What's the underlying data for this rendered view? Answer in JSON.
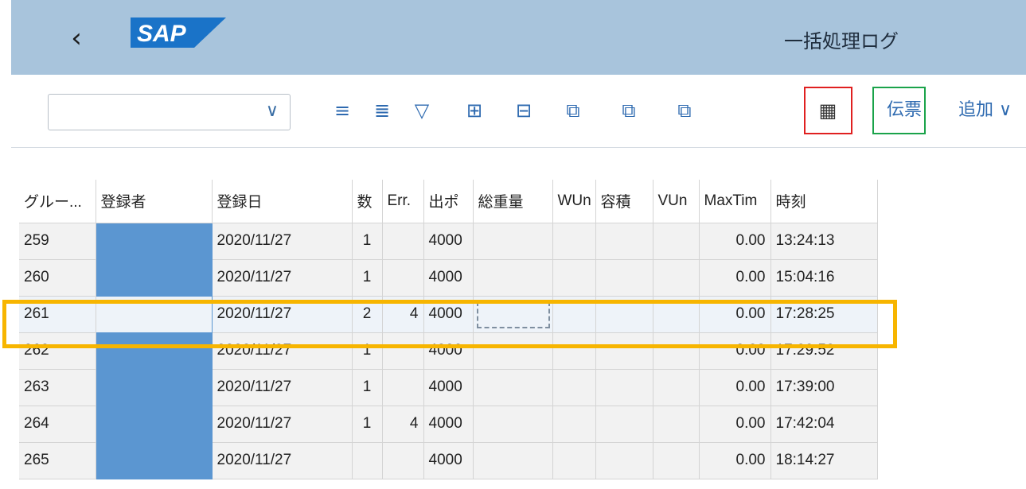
{
  "header": {
    "title": "一括処理ログ",
    "logo_text": "SAP"
  },
  "toolbar": {
    "select_value": "",
    "doc_label": "伝票",
    "add_label": "追加 ∨",
    "icons": [
      "sort-ascending-icon",
      "sort-descending-icon",
      "filter-icon",
      "expand-icon",
      "collapse-icon",
      "copy-icon",
      "copy-icon",
      "copy-icon",
      "batch-icon"
    ]
  },
  "table": {
    "columns": [
      "グルー...",
      "登録者",
      "登録日",
      "数",
      "Err.",
      "出ポ",
      "総重量",
      "WUn",
      "容積",
      "VUn",
      "MaxTim",
      "時刻"
    ],
    "rows": [
      {
        "group": "259",
        "user": "",
        "date": "2020/11/27",
        "count": "1",
        "err": "",
        "out": "4000",
        "weight": "",
        "wun": "",
        "vol": "",
        "vun": "",
        "maxtim": "0.00",
        "time": "13:24:13"
      },
      {
        "group": "260",
        "user": "",
        "date": "2020/11/27",
        "count": "1",
        "err": "",
        "out": "4000",
        "weight": "",
        "wun": "",
        "vol": "",
        "vun": "",
        "maxtim": "0.00",
        "time": "15:04:16"
      },
      {
        "group": "261",
        "user": "",
        "date": "2020/11/27",
        "count": "2",
        "err": "4",
        "out": "4000",
        "weight": "",
        "wun": "",
        "vol": "",
        "vun": "",
        "maxtim": "0.00",
        "time": "17:28:25"
      },
      {
        "group": "262",
        "user": "",
        "date": "2020/11/27",
        "count": "1",
        "err": "",
        "out": "4000",
        "weight": "",
        "wun": "",
        "vol": "",
        "vun": "",
        "maxtim": "0.00",
        "time": "17:29:52"
      },
      {
        "group": "263",
        "user": "",
        "date": "2020/11/27",
        "count": "1",
        "err": "",
        "out": "4000",
        "weight": "",
        "wun": "",
        "vol": "",
        "vun": "",
        "maxtim": "0.00",
        "time": "17:39:00"
      },
      {
        "group": "264",
        "user": "",
        "date": "2020/11/27",
        "count": "1",
        "err": "4",
        "out": "4000",
        "weight": "",
        "wun": "",
        "vol": "",
        "vun": "",
        "maxtim": "0.00",
        "time": "17:42:04"
      },
      {
        "group": "265",
        "user": "",
        "date": "2020/11/27",
        "count": "",
        "err": "",
        "out": "4000",
        "weight": "",
        "wun": "",
        "vol": "",
        "vun": "",
        "maxtim": "0.00",
        "time": "18:14:27"
      }
    ]
  },
  "colors": {
    "header_bg": "#a8c4dc",
    "accent": "#2e6ab0",
    "redacted": "#5b96d1",
    "highlight_row": "#f7b500",
    "red_box": "#e02020",
    "green_box": "#1aa34a"
  }
}
